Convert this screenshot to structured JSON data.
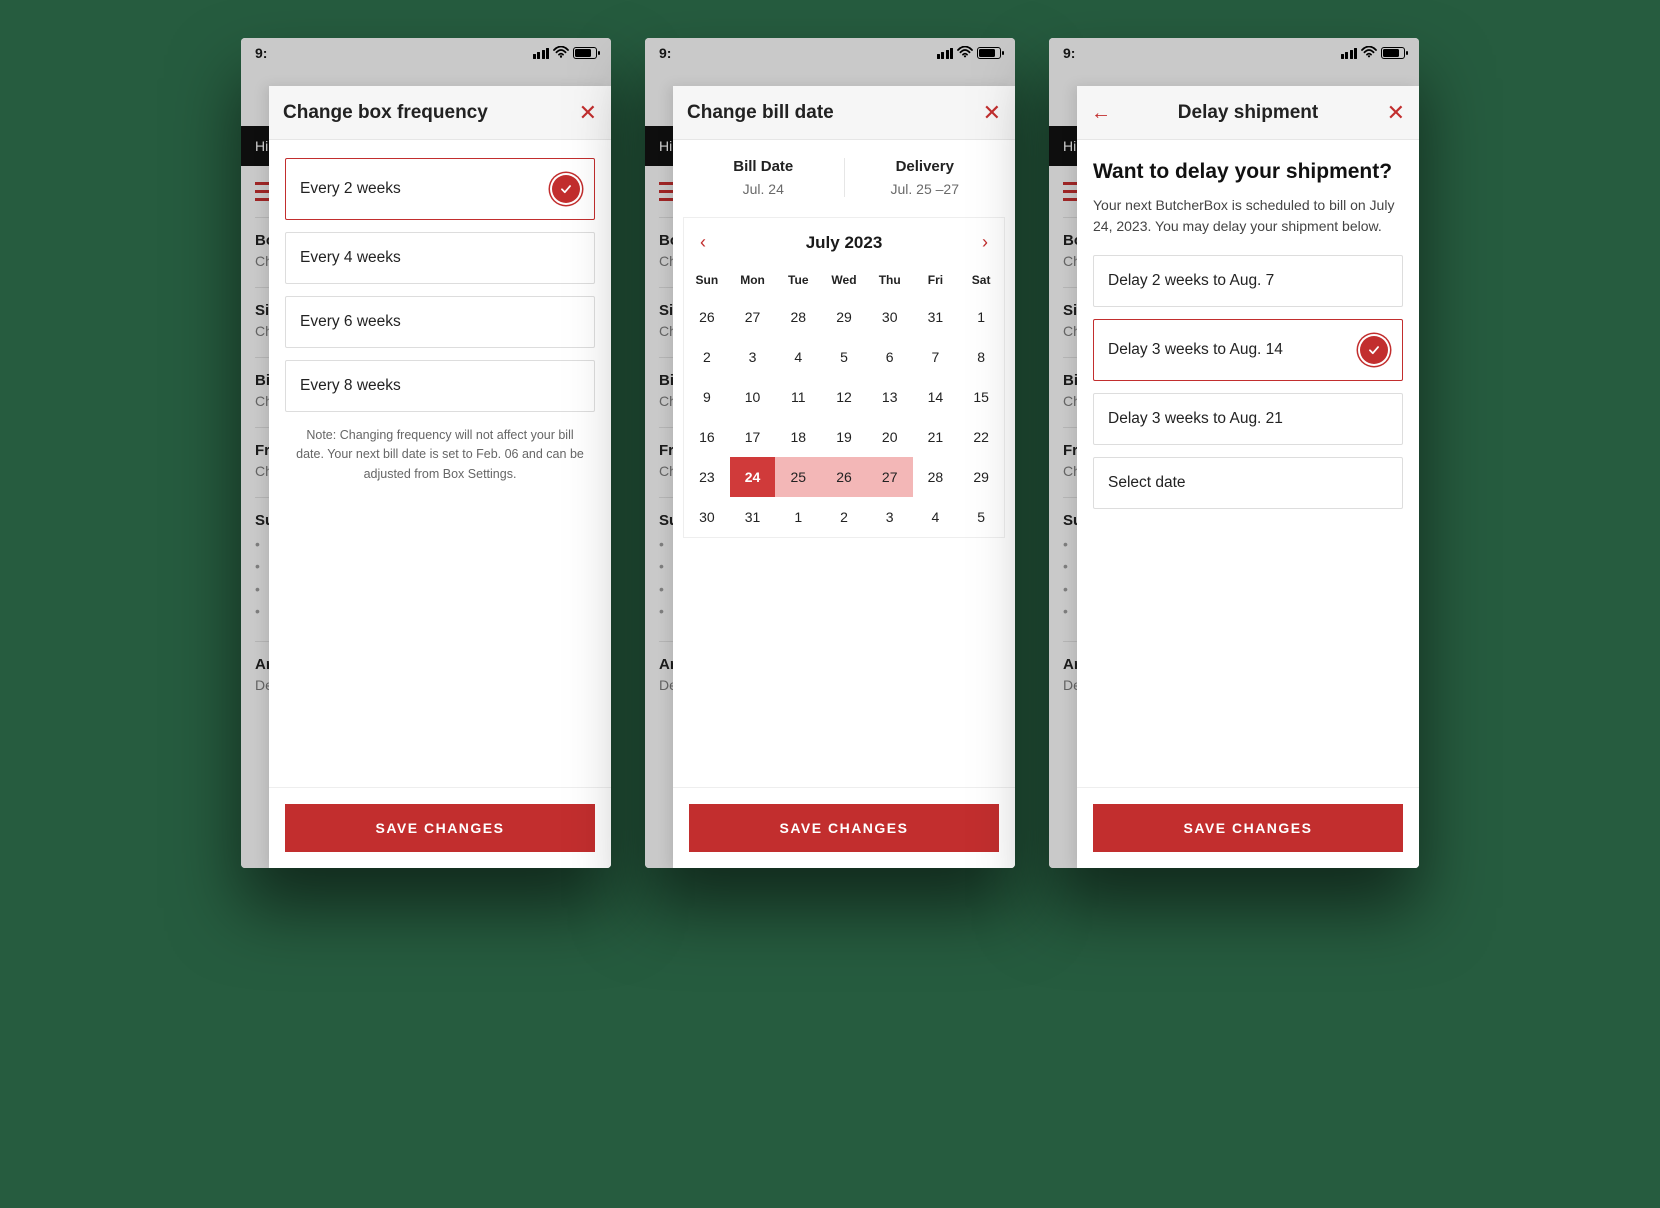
{
  "status_time": "9:",
  "under": {
    "greeting": "Hi",
    "rows": [
      {
        "lbl": "Bo",
        "sub": "Ch"
      },
      {
        "lbl": "Si",
        "sub": "Ch"
      },
      {
        "lbl": "Bi",
        "sub": "Ch"
      },
      {
        "lbl": "Fr",
        "sub": "Ch"
      },
      {
        "lbl": "Su",
        "sub": ""
      },
      {
        "lbl": "Ar",
        "sub": "De"
      }
    ]
  },
  "freq": {
    "title": "Change box frequency",
    "options": [
      {
        "label": "Every 2 weeks",
        "selected": true
      },
      {
        "label": "Every 4 weeks",
        "selected": false
      },
      {
        "label": "Every 6 weeks",
        "selected": false
      },
      {
        "label": "Every 8 weeks",
        "selected": false
      }
    ],
    "note": "Note: Changing frequency will not affect your bill date. Your next bill date is set to Feb. 06 and can be adjusted from Box Settings.",
    "save": "SAVE CHANGES"
  },
  "bill": {
    "title": "Change bill date",
    "bill_label": "Bill Date",
    "bill_value": "Jul. 24",
    "delivery_label": "Delivery",
    "delivery_value": "Jul. 25 –27",
    "month": "July 2023",
    "dows": [
      "Sun",
      "Mon",
      "Tue",
      "Wed",
      "Thu",
      "Fri",
      "Sat"
    ],
    "weeks": [
      [
        {
          "d": "26"
        },
        {
          "d": "27"
        },
        {
          "d": "28"
        },
        {
          "d": "29"
        },
        {
          "d": "30"
        },
        {
          "d": "31"
        },
        {
          "d": "1"
        }
      ],
      [
        {
          "d": "2"
        },
        {
          "d": "3"
        },
        {
          "d": "4"
        },
        {
          "d": "5"
        },
        {
          "d": "6"
        },
        {
          "d": "7"
        },
        {
          "d": "8"
        }
      ],
      [
        {
          "d": "9"
        },
        {
          "d": "10"
        },
        {
          "d": "11"
        },
        {
          "d": "12"
        },
        {
          "d": "13"
        },
        {
          "d": "14"
        },
        {
          "d": "15"
        }
      ],
      [
        {
          "d": "16"
        },
        {
          "d": "17"
        },
        {
          "d": "18"
        },
        {
          "d": "19"
        },
        {
          "d": "20"
        },
        {
          "d": "21"
        },
        {
          "d": "22"
        }
      ],
      [
        {
          "d": "23"
        },
        {
          "d": "24",
          "sel": true
        },
        {
          "d": "25",
          "range": true
        },
        {
          "d": "26",
          "range": true
        },
        {
          "d": "27",
          "range": true
        },
        {
          "d": "28"
        },
        {
          "d": "29"
        }
      ],
      [
        {
          "d": "30"
        },
        {
          "d": "31"
        },
        {
          "d": "1"
        },
        {
          "d": "2"
        },
        {
          "d": "3"
        },
        {
          "d": "4"
        },
        {
          "d": "5"
        }
      ]
    ],
    "save": "SAVE CHANGES"
  },
  "delay": {
    "title": "Delay shipment",
    "heading": "Want to delay your shipment?",
    "desc": "Your next ButcherBox is scheduled to bill on July 24, 2023. You may delay your shipment below.",
    "options": [
      {
        "label": "Delay 2 weeks to Aug. 7",
        "selected": false
      },
      {
        "label": "Delay 3 weeks to Aug. 14",
        "selected": true
      },
      {
        "label": "Delay 3 weeks to Aug. 21",
        "selected": false
      },
      {
        "label": "Select date",
        "selected": false
      }
    ],
    "save": "SAVE CHANGES"
  }
}
